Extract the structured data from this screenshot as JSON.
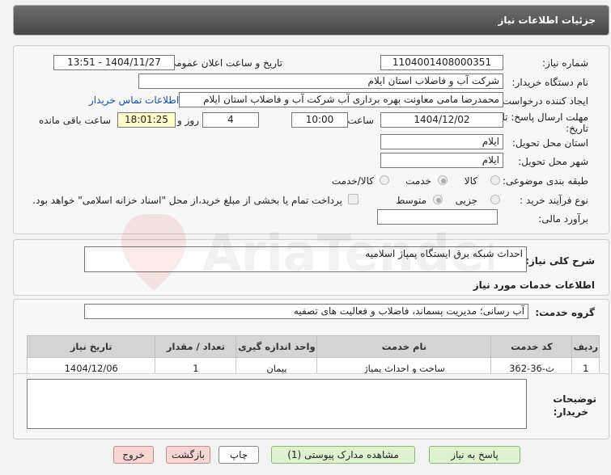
{
  "header": {
    "title": "جزئیات اطلاعات نیاز"
  },
  "form": {
    "need_number_label": "شماره نیاز:",
    "need_number": "1104001408000351",
    "announce_label": "تاریخ و ساعت اعلان عمومی:",
    "announce_value": "1404/11/27 - 13:51",
    "buyer_org_label": "نام دستگاه خریدار:",
    "buyer_org": "شرکت آب و فاضلاب استان ایلام",
    "creator_label": "ایجاد کننده درخواست:",
    "creator": "محمدرضا مامی معاونت بهره برداری آب  شرکت آب و فاضلاب استان ایلام",
    "contact_link": "اطلاعات تماس خریدار",
    "deadline_label_line1": "مهلت ارسال پاسخ: تا",
    "deadline_label_line2": "تاریخ:",
    "deadline_date": "1404/12/02",
    "time_label": "ساعت",
    "deadline_time": "10:00",
    "days_value": "4",
    "days_label": "روز و",
    "remaining_time": "18:01:25",
    "remaining_label": "ساعت باقی مانده",
    "province_label": "استان محل تحویل:",
    "province": "ایلام",
    "city_label": "شهر محل تحویل:",
    "city": "ایلام",
    "category_label": "طبقه بندی موضوعی:",
    "category_options": [
      "کالا",
      "خدمت",
      "کالا/خدمت"
    ],
    "category_selected": "خدمت",
    "process_label": "نوع فرآیند خرید :",
    "process_options": [
      "جزیی",
      "متوسط"
    ],
    "process_selected": "متوسط",
    "payment_note": "پرداخت تمام یا بخشی از مبلغ خرید،از محل \"اسناد خزانه اسلامی\" خواهد بود.",
    "budget_label": "برآورد مالی:",
    "budget_value": ""
  },
  "description": {
    "label": "شرح کلی نیاز:",
    "value": "احداث شبکه برق ایستگاه پمپاژ اسلامیه"
  },
  "services": {
    "section_title": "اطلاعات خدمات مورد نیاز",
    "group_label": "گروه خدمت:",
    "group_value": "آب رسانی؛ مدیریت پسماند، فاضلاب و فعالیت های تصفیه",
    "table": {
      "headers": [
        "ردیف",
        "کد خدمت",
        "نام خدمت",
        "واحد اندازه گیری",
        "تعداد / مقدار",
        "تاریخ نیاز"
      ],
      "rows": [
        [
          "1",
          "ث-36-362",
          "ساخت و احداث پمپاژ",
          "پیمان",
          "1",
          "1404/12/06"
        ]
      ]
    }
  },
  "buyer_notes": {
    "label_line1": "توضیحات",
    "label_line2": "خریدار:",
    "value": ""
  },
  "buttons": {
    "reply": "پاسخ به نیاز",
    "view_docs": "مشاهده مدارک پیوستی (1)",
    "print": "چاپ",
    "back": "بازگشت",
    "exit": "خروج"
  },
  "colors": {
    "title_bar": "#555555",
    "remaining_bg": "#ffffcc",
    "link": "#1a4fa3",
    "green_btn": "#dff2d0",
    "red_btn": "#f9d6d6"
  },
  "watermark": {
    "text": "AriaTender.net"
  }
}
